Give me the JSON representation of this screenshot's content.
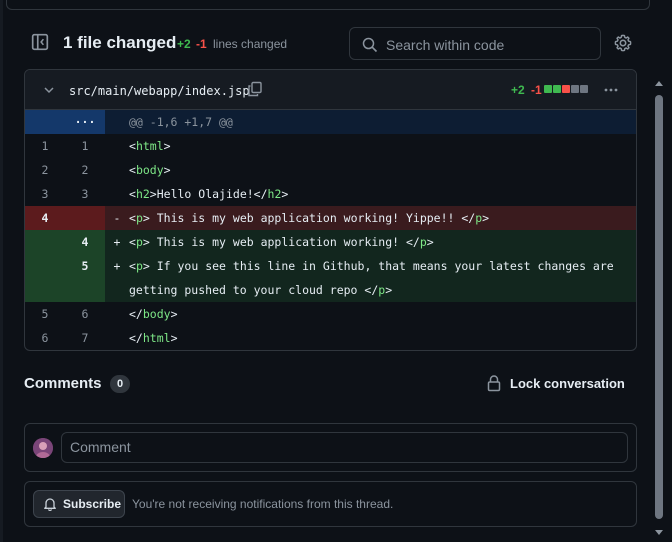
{
  "toolbar": {
    "title": "1 file changed",
    "additions": "+2",
    "deletions": "-1",
    "lines_changed_label": "lines changed",
    "search_placeholder": "Search within code"
  },
  "file": {
    "path": "src/main/webapp/index.jsp",
    "additions": "+2",
    "deletions": "-1",
    "diffstat_colors": [
      "#3fb950",
      "#3fb950",
      "#f85149",
      "#6e7681",
      "#6e7681"
    ]
  },
  "diff": {
    "hunk_header": "@@ -1,6 +1,7 @@",
    "expand_label": "···",
    "rows": [
      {
        "type": "ctx",
        "old": "1",
        "new": "1",
        "sign": "",
        "code": "<html>"
      },
      {
        "type": "ctx",
        "old": "2",
        "new": "2",
        "sign": "",
        "code": "<body>"
      },
      {
        "type": "ctx",
        "old": "3",
        "new": "3",
        "sign": "",
        "code": "<h2>Hello Olajide!</h2>"
      },
      {
        "type": "del",
        "old": "4",
        "new": "",
        "sign": "-",
        "code": "<p> This is my web application working! Yippe!! </p>"
      },
      {
        "type": "add",
        "old": "",
        "new": "4",
        "sign": "+",
        "code": "<p> This is my web application working! </p>"
      },
      {
        "type": "add",
        "old": "",
        "new": "5",
        "sign": "+",
        "code": "<p> If you see this line in Github, that means your latest changes are getting pushed to your cloud repo </p>"
      },
      {
        "type": "ctx",
        "old": "5",
        "new": "6",
        "sign": "",
        "code": "</body>"
      },
      {
        "type": "ctx",
        "old": "6",
        "new": "7",
        "sign": "",
        "code": "</html>"
      }
    ]
  },
  "comments": {
    "title": "Comments",
    "count": "0",
    "lock_label": "Lock conversation",
    "input_placeholder": "Comment"
  },
  "subscription": {
    "button_label": "Subscribe",
    "status_text": "You're not receiving notifications from this thread."
  }
}
